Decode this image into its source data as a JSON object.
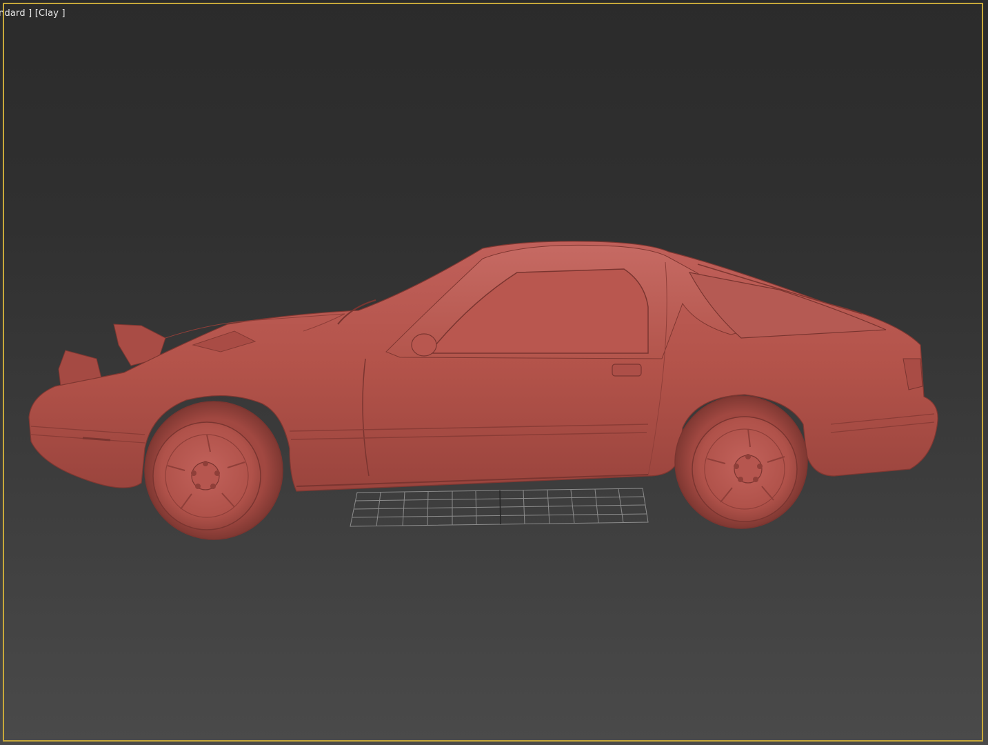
{
  "viewport": {
    "label_left": "ndard ]",
    "label_right": "[Clay ]"
  },
  "colors": {
    "border": "#c7a83a",
    "body": "#b3534a",
    "body_light": "#c2605a",
    "body_dark": "#8f3e38",
    "grid": "#9a9a9a"
  }
}
